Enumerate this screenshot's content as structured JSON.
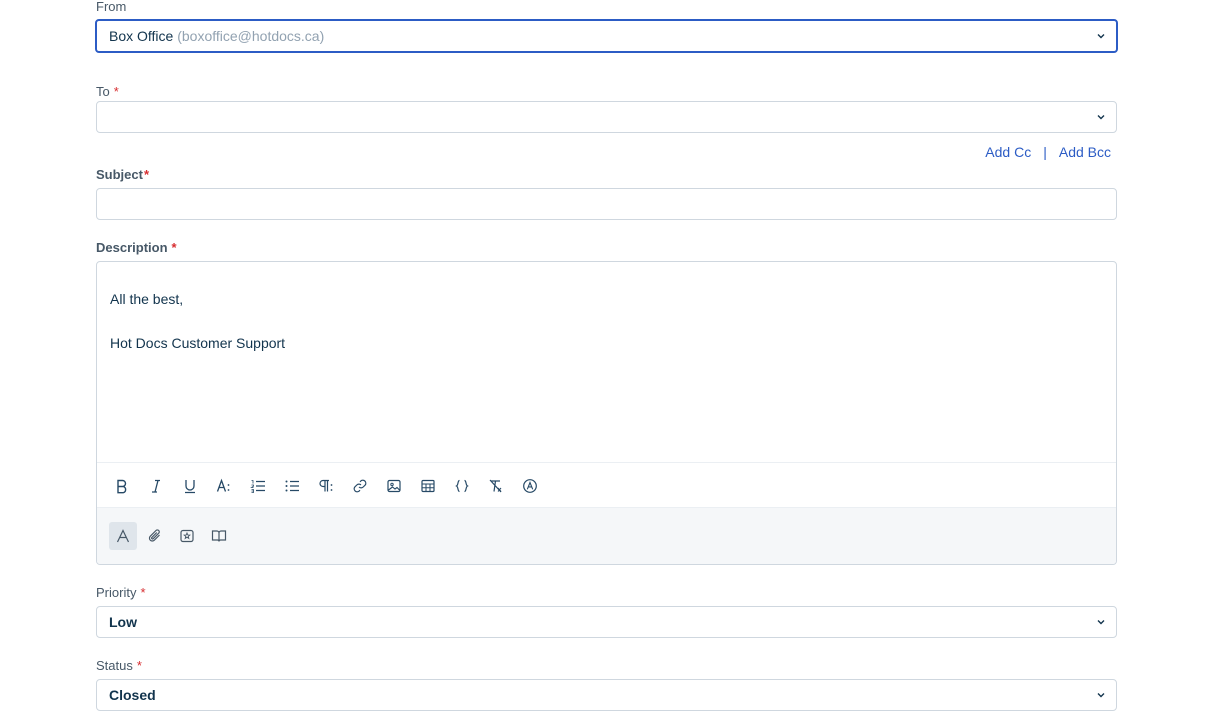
{
  "from": {
    "label": "From",
    "name": "Box Office",
    "email": "(boxoffice@hotdocs.ca)"
  },
  "to": {
    "label": "To",
    "required": "*",
    "value": ""
  },
  "cc_links": {
    "add_cc": "Add Cc",
    "separator": "|",
    "add_bcc": "Add Bcc"
  },
  "subject": {
    "label": "Subject",
    "required": "*",
    "value": ""
  },
  "description": {
    "label": "Description",
    "required": "*",
    "lines": [
      "All the best,",
      "Hot Docs Customer Support"
    ]
  },
  "toolbar_icons": [
    "bold-icon",
    "italic-icon",
    "underline-icon",
    "font-size-icon",
    "ordered-list-icon",
    "bullet-list-icon",
    "paragraph-format-icon",
    "link-icon",
    "image-icon",
    "table-icon",
    "code-icon",
    "clear-format-icon",
    "spell-check-icon"
  ],
  "bottom_icons": [
    "text-format-icon",
    "attachment-icon",
    "canned-response-icon",
    "solution-article-icon"
  ],
  "priority": {
    "label": "Priority",
    "required": "*",
    "value": "Low"
  },
  "status": {
    "label": "Status",
    "required": "*",
    "value": "Closed"
  },
  "colors": {
    "accent": "#2c5cc5",
    "required": "#d72d30",
    "border": "#cfd7df"
  }
}
